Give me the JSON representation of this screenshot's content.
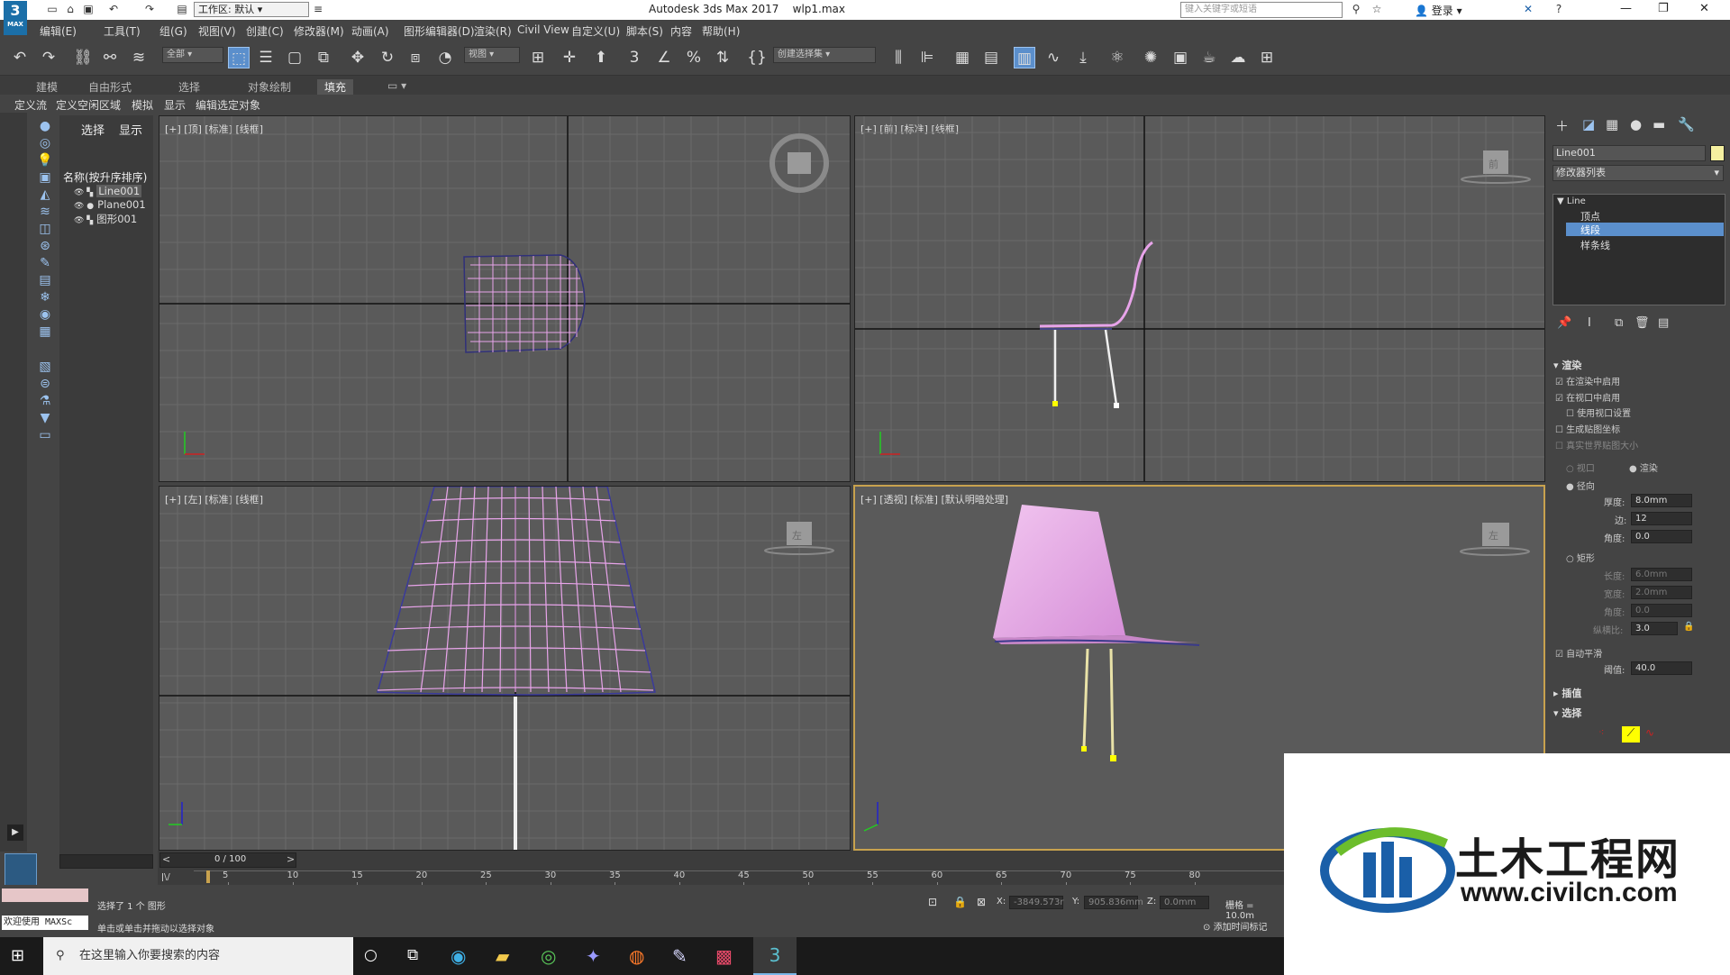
{
  "title_bar": {
    "app_logo": "3",
    "app_logo_sub": "MAX",
    "workspace": "工作区: 默认",
    "app_title": "Autodesk 3ds Max 2017",
    "file_name": "wlp1.max",
    "search_placeholder": "键入关键字或短语",
    "login": "登录"
  },
  "menu": [
    "编辑(E)",
    "工具(T)",
    "组(G)",
    "视图(V)",
    "创建(C)",
    "修改器(M)",
    "动画(A)",
    "图形编辑器(D)",
    "渲染(R)",
    "Civil View",
    "自定义(U)",
    "脚本(S)",
    "内容",
    "帮助(H)"
  ],
  "toolbar": {
    "selection_filter": "全部",
    "ref_coord": "视图",
    "named_selection": "创建选择集"
  },
  "ribbon_tabs": [
    "建模",
    "自由形式",
    "选择",
    "对象绘制",
    "填充"
  ],
  "sub_tabs": [
    "定义流",
    "定义空闲区域",
    "模拟",
    "显示",
    "编辑选定对象"
  ],
  "scene_explorer": {
    "tabs": [
      "选择",
      "显示"
    ],
    "header": "名称(按升序排序)",
    "objects": [
      "Line001",
      "Plane001",
      "图形001"
    ]
  },
  "viewports": {
    "top": "[+] [顶] [标准] [线框]",
    "front": "[+] [前] [标准] [线框]",
    "left": "[+] [左] [标准] [线框]",
    "persp": "[+] [透视] [标准] [默认明暗处理]",
    "front_cube_label": "前",
    "left_cube_label": "左",
    "persp_cube_label": "左"
  },
  "command_panel": {
    "object_name": "Line001",
    "object_color": "#f5f0a0",
    "modifier_list": "修改器列表",
    "stack": [
      "Line",
      "顶点",
      "线段",
      "样条线"
    ],
    "rollout_render": "渲染",
    "cb_enable_render": "在渲染中启用",
    "cb_enable_viewport": "在视口中启用",
    "cb_use_viewport": "使用视口设置",
    "cb_gen_mapping": "生成贴图坐标",
    "cb_real_world": "真实世界贴图大小",
    "rb_viewport": "视口",
    "rb_render": "渲染",
    "rb_radial": "径向",
    "thickness_label": "厚度:",
    "thickness": "8.0mm",
    "sides_label": "边:",
    "sides": "12",
    "angle_label": "角度:",
    "angle": "0.0",
    "rb_rect": "矩形",
    "length_label": "长度:",
    "length": "6.0mm",
    "width_label": "宽度:",
    "width": "2.0mm",
    "angle2_label": "角度:",
    "angle2": "0.0",
    "aspect_label": "纵横比:",
    "aspect": "3.0",
    "cb_autosmooth": "自动平滑",
    "threshold_label": "阈值:",
    "threshold": "40.0",
    "rollout_interp": "插值",
    "rollout_select": "选择"
  },
  "timeline": {
    "frame": "0 / 100",
    "ticks": [
      "5",
      "10",
      "15",
      "20",
      "25",
      "30",
      "35",
      "40",
      "45",
      "50",
      "55",
      "60",
      "65",
      "70",
      "75",
      "80"
    ]
  },
  "status": {
    "maxscript": "欢迎使用 MAXSc",
    "selected": "选择了 1 个 图形",
    "prompt": "单击或单击并拖动以选择对象",
    "x_label": "X:",
    "x": "-3849.573r",
    "y_label": "Y:",
    "y": "905.836mm",
    "z_label": "Z:",
    "z": "0.0mm",
    "grid": "栅格 = 10.0m",
    "add_time_tag": "添加时间标记"
  },
  "taskbar": {
    "search": "在这里输入你要搜索的内容"
  },
  "watermark": {
    "cn": "土木工程网",
    "url": "www.civilcn.com"
  }
}
